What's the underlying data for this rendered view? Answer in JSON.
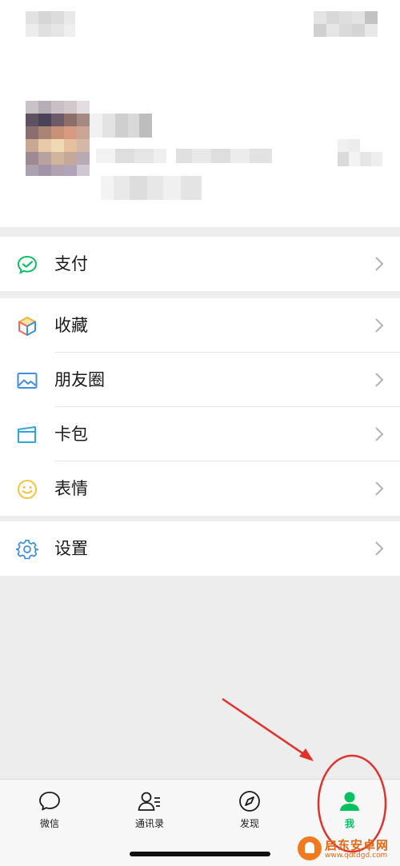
{
  "menu": {
    "pay": {
      "label": "支付"
    },
    "favorites": {
      "label": "收藏"
    },
    "moments": {
      "label": "朋友圈"
    },
    "cards": {
      "label": "卡包"
    },
    "stickers": {
      "label": "表情"
    },
    "settings": {
      "label": "设置"
    }
  },
  "tabbar": {
    "chats": "微信",
    "contacts": "通讯录",
    "discover": "发现",
    "me": "我"
  },
  "colors": {
    "accent": "#07c160",
    "annotation": "#e0322b"
  },
  "watermark": {
    "name": "启东安卓网",
    "url": "www.qdtdgd.com"
  }
}
